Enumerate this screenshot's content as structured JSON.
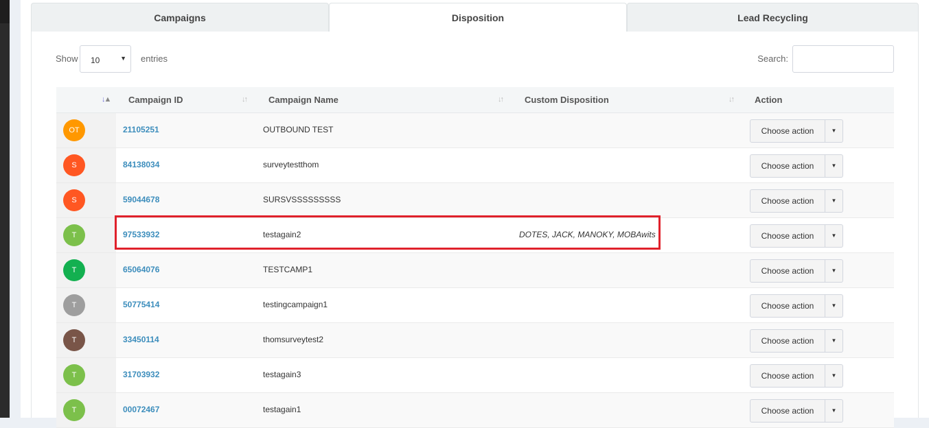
{
  "tabs": [
    {
      "label": "Campaigns",
      "active": false
    },
    {
      "label": "Disposition",
      "active": true
    },
    {
      "label": "Lead Recycling",
      "active": false
    }
  ],
  "controls": {
    "show_label": "Show",
    "entries_value": "10",
    "entries_label": "entries",
    "search_label": "Search:",
    "search_value": ""
  },
  "table": {
    "columns": [
      "Campaign ID",
      "Campaign Name",
      "Custom Disposition",
      "Action"
    ],
    "action_label": "Choose action",
    "rows": [
      {
        "avatar": "OT",
        "avatar_color": "#ff9800",
        "id": "21105251",
        "name": "OUTBOUND TEST",
        "disposition": ""
      },
      {
        "avatar": "S",
        "avatar_color": "#ff5722",
        "id": "84138034",
        "name": "surveytestthom",
        "disposition": ""
      },
      {
        "avatar": "S",
        "avatar_color": "#ff5722",
        "id": "59044678",
        "name": "SURSVSSSSSSSSS",
        "disposition": ""
      },
      {
        "avatar": "T",
        "avatar_color": "#7cc04b",
        "id": "97533932",
        "name": "testagain2",
        "disposition": "DOTES, JACK, MANOKY, MOBAwits"
      },
      {
        "avatar": "T",
        "avatar_color": "#13b050",
        "id": "65064076",
        "name": "TESTCAMP1",
        "disposition": ""
      },
      {
        "avatar": "T",
        "avatar_color": "#9e9e9e",
        "id": "50775414",
        "name": "testingcampaign1",
        "disposition": ""
      },
      {
        "avatar": "T",
        "avatar_color": "#795548",
        "id": "33450114",
        "name": "thomsurveytest2",
        "disposition": ""
      },
      {
        "avatar": "T",
        "avatar_color": "#7cc04b",
        "id": "31703932",
        "name": "testagain3",
        "disposition": ""
      },
      {
        "avatar": "T",
        "avatar_color": "#7cc04b",
        "id": "00072467",
        "name": "testagain1",
        "disposition": ""
      }
    ]
  },
  "colors": {
    "accent_link": "#3c8dbc",
    "highlight_box": "#e0212b"
  }
}
